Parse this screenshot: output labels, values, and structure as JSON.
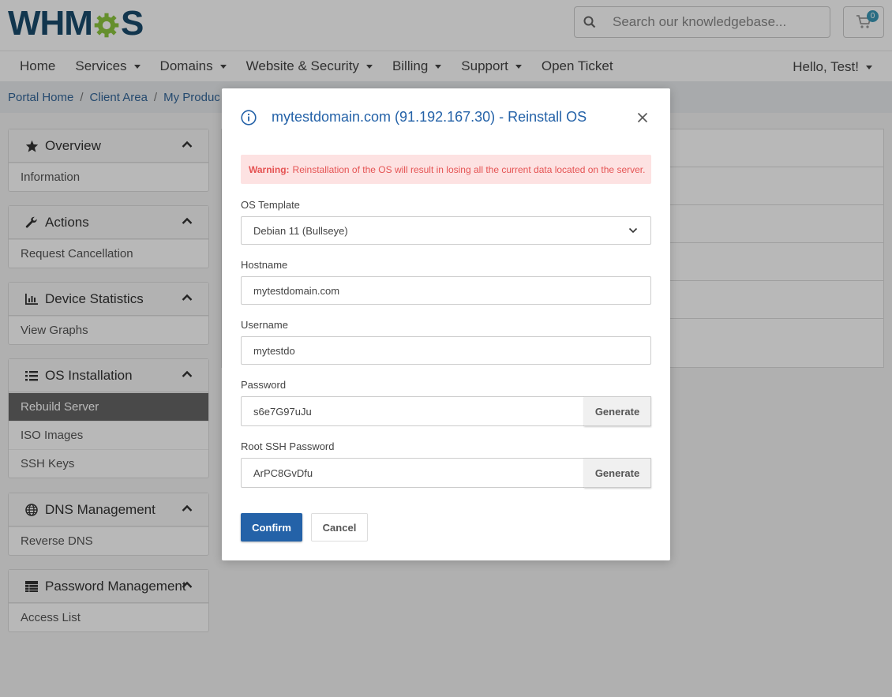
{
  "header": {
    "logo_text_left": "WHM",
    "logo_text_right": "S",
    "search_placeholder": "Search our knowledgebase...",
    "cart_count": "0"
  },
  "nav": {
    "items": [
      {
        "label": "Home",
        "has_caret": false
      },
      {
        "label": "Services",
        "has_caret": true
      },
      {
        "label": "Domains",
        "has_caret": true
      },
      {
        "label": "Website & Security",
        "has_caret": true
      },
      {
        "label": "Billing",
        "has_caret": true
      },
      {
        "label": "Support",
        "has_caret": true
      },
      {
        "label": "Open Ticket",
        "has_caret": false
      }
    ],
    "user_greeting": "Hello, Test!"
  },
  "breadcrumb": [
    "Portal Home",
    "Client Area",
    "My Produc"
  ],
  "sidebar": {
    "panels": [
      {
        "title": "Overview",
        "icon": "star-icon",
        "items": [
          {
            "label": "Information",
            "active": false
          }
        ]
      },
      {
        "title": "Actions",
        "icon": "wrench-icon",
        "items": [
          {
            "label": "Request Cancellation",
            "active": false
          }
        ]
      },
      {
        "title": "Device Statistics",
        "icon": "bar-chart-icon",
        "items": [
          {
            "label": "View Graphs",
            "active": false
          }
        ]
      },
      {
        "title": "OS Installation",
        "icon": "list-icon",
        "items": [
          {
            "label": "Rebuild Server",
            "active": true
          },
          {
            "label": "ISO Images",
            "active": false
          },
          {
            "label": "SSH Keys",
            "active": false
          }
        ]
      },
      {
        "title": "DNS Management",
        "icon": "globe-icon",
        "items": [
          {
            "label": "Reverse DNS",
            "active": false
          }
        ]
      },
      {
        "title": "Password Management",
        "icon": "table-icon",
        "items": [
          {
            "label": "Access List",
            "active": false
          }
        ]
      }
    ]
  },
  "modal": {
    "title": "mytestdomain.com (91.192.167.30) - Reinstall OS",
    "warning_strong": "Warning:",
    "warning_text": "Reinstallation of the OS will result in losing all the current data located on the server.",
    "os_template_label": "OS Template",
    "os_template_value": "Debian 11 (Bullseye)",
    "hostname_label": "Hostname",
    "hostname_value": "mytestdomain.com",
    "username_label": "Username",
    "username_value": "mytestdo",
    "password_label": "Password",
    "password_value": "s6e7G97uJu",
    "root_password_label": "Root SSH Password",
    "root_password_value": "ArPC8GvDfu",
    "generate_label": "Generate",
    "confirm_label": "Confirm",
    "cancel_label": "Cancel"
  },
  "colors": {
    "accent": "#2462a8",
    "warning_bg": "#fde2e2",
    "warning_text": "#e55353",
    "logo_blue": "#1a4b6d",
    "logo_green": "#8dc63f"
  }
}
